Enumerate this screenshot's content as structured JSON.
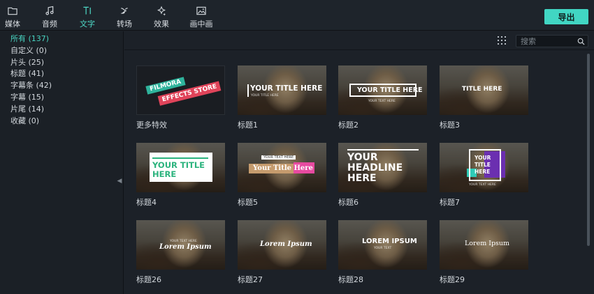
{
  "toolbar": {
    "tools": [
      {
        "label": "媒体",
        "icon": "folder-icon"
      },
      {
        "label": "音频",
        "icon": "music-note-icon"
      },
      {
        "label": "文字",
        "icon": "text-icon",
        "active": true
      },
      {
        "label": "转场",
        "icon": "transition-icon"
      },
      {
        "label": "效果",
        "icon": "sparkle-effects-icon"
      },
      {
        "label": "画中画",
        "icon": "picture-in-picture-icon"
      }
    ],
    "export_label": "导出"
  },
  "sidebar": {
    "items": [
      {
        "label": "所有 (137)",
        "active": true
      },
      {
        "label": "自定义 (0)"
      },
      {
        "label": "片头 (25)"
      },
      {
        "label": "标题 (41)"
      },
      {
        "label": "字幕条 (42)"
      },
      {
        "label": "字幕 (15)"
      },
      {
        "label": "片尾 (14)"
      },
      {
        "label": "收藏 (0)"
      }
    ]
  },
  "search": {
    "placeholder": "搜索",
    "value": ""
  },
  "thumbnails": [
    {
      "caption": "更多特效",
      "overlay": [
        "FILMORA",
        "EFFECTS STORE"
      ]
    },
    {
      "caption": "标题1",
      "overlay": [
        "YOUR TITLE HERE",
        "YOUR TITLE HERE"
      ]
    },
    {
      "caption": "标题2",
      "overlay": [
        "YOUR TITLE HERE",
        "YOUR TEXT HERE"
      ]
    },
    {
      "caption": "标题3",
      "overlay": [
        "TITLE HERE"
      ]
    },
    {
      "caption": "标题4",
      "overlay": [
        "YOUR TITLE",
        "HERE"
      ]
    },
    {
      "caption": "标题5",
      "overlay": [
        "YOUR TEXT HERE",
        "Your Title Here"
      ]
    },
    {
      "caption": "标题6",
      "overlay": [
        "YOUR",
        "HEADLINE",
        "HERE"
      ]
    },
    {
      "caption": "标题7",
      "overlay": [
        "YOUR",
        "TITLE",
        "HERE",
        "YOUR TEXT HERE"
      ]
    },
    {
      "caption": "标题26",
      "overlay": [
        "YOUR TEXT HERE",
        "Lorem Ipsum"
      ]
    },
    {
      "caption": "标题27",
      "overlay": [
        "Lorem Ipsum"
      ]
    },
    {
      "caption": "标题28",
      "overlay": [
        "LOREM IPSUM",
        "YOUR TEXT"
      ]
    },
    {
      "caption": "标题29",
      "overlay": [
        "Lorem Ipsum"
      ]
    }
  ],
  "colors": {
    "accent": "#41d6c3",
    "background": "#1c2128",
    "promo_teal": "#2fb39c",
    "promo_red": "#e0445a",
    "title_green": "#2bb37d",
    "title_pink": "#e74aa0",
    "title_purple": "#6b2fb0"
  }
}
